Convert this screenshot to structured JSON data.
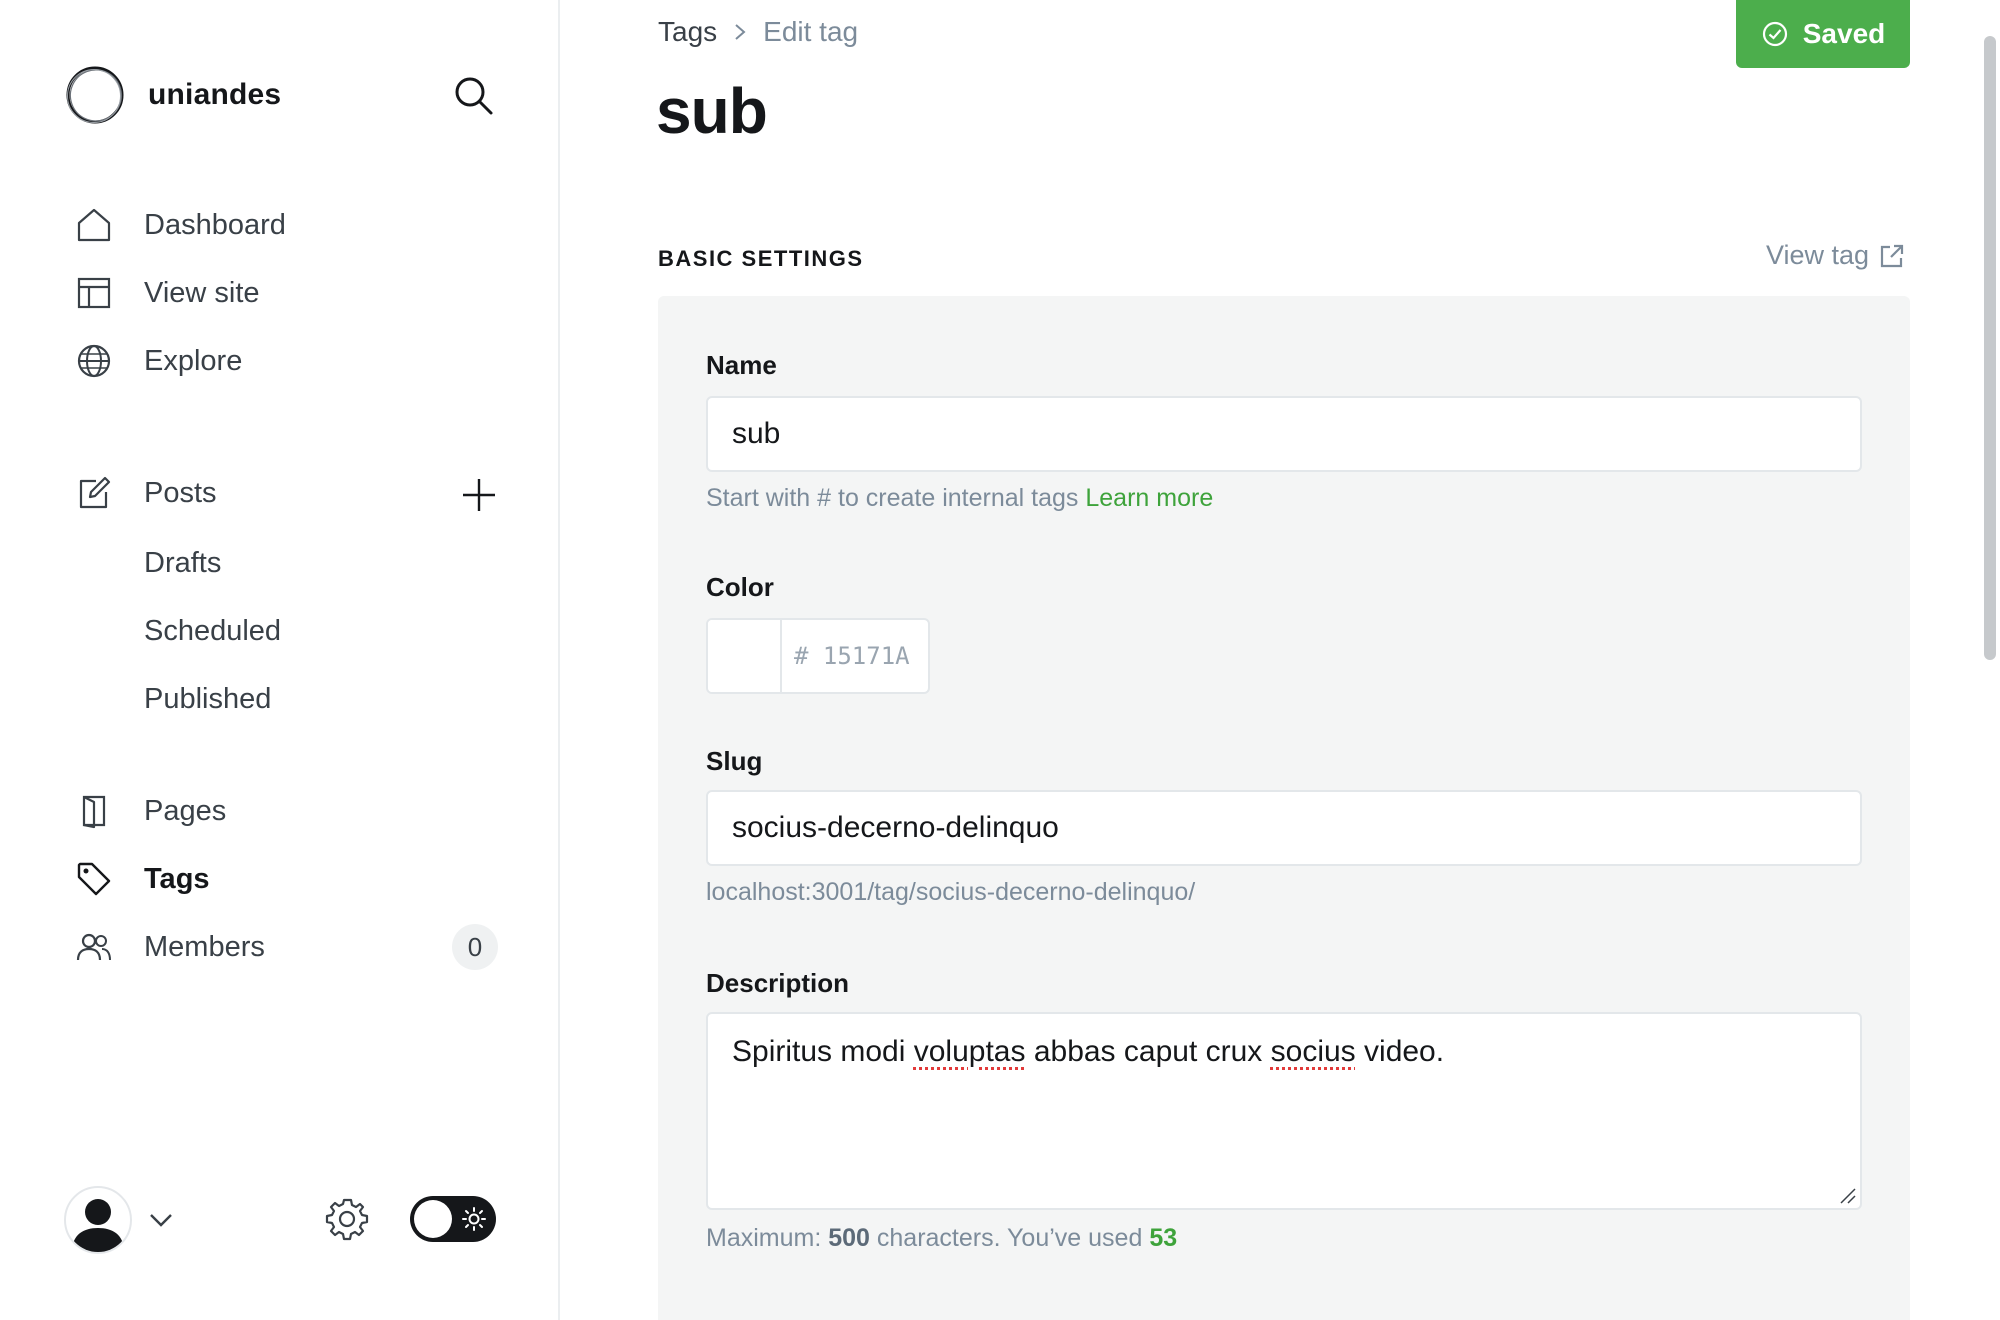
{
  "sidebar": {
    "brand": "uniandes",
    "nav": {
      "dashboard": "Dashboard",
      "view_site": "View site",
      "explore": "Explore",
      "posts": "Posts",
      "drafts": "Drafts",
      "scheduled": "Scheduled",
      "published": "Published",
      "pages": "Pages",
      "tags": "Tags",
      "members": "Members",
      "members_count": "0"
    }
  },
  "header": {
    "breadcrumb_root": "Tags",
    "breadcrumb_current": "Edit tag",
    "title": "sub",
    "saved_label": "Saved"
  },
  "section": {
    "label": "BASIC SETTINGS",
    "view_tag": "View tag"
  },
  "form": {
    "name_label": "Name",
    "name_value": "sub",
    "name_hint": "Start with # to create internal tags",
    "learn_more": "Learn more",
    "color_label": "Color",
    "color_hash": "#",
    "color_value": "15171A",
    "slug_label": "Slug",
    "slug_value": "socius-decerno-delinquo",
    "slug_url": "localhost:3001/tag/socius-decerno-delinquo/",
    "description_label": "Description",
    "description_parts": {
      "p1": "Spiritus modi ",
      "w1": "voluptas",
      "p2": " abbas caput crux ",
      "w2": "socius",
      "p3": " video."
    },
    "desc_hint_prefix": "Maximum: ",
    "desc_max": "500",
    "desc_hint_mid": " characters. You’ve used ",
    "desc_used": "53"
  },
  "colors": {
    "accent_green": "#4cae4c",
    "text_dark": "#15171a",
    "muted": "#7c8b9a"
  }
}
